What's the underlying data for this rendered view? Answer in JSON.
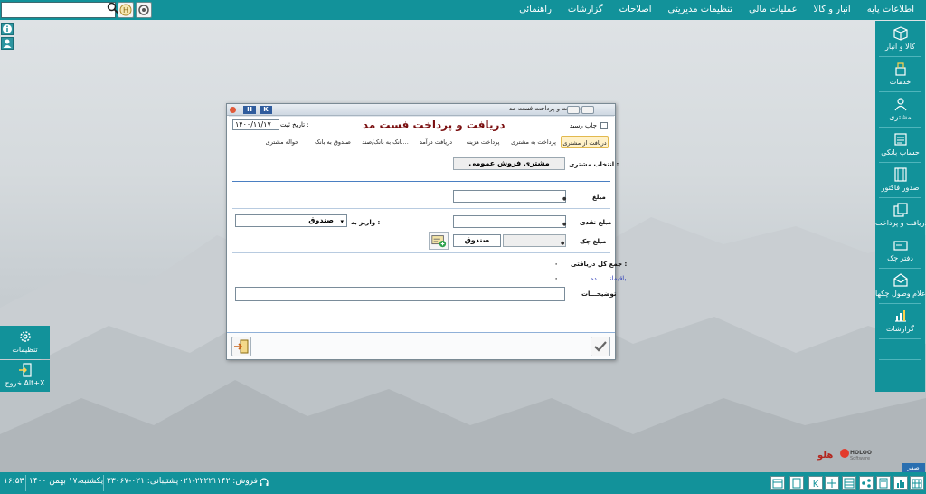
{
  "menu": [
    "اطلاعات پایه",
    "انبار و کالا",
    "عملیات مالی",
    "تنظیمات مدیریتی",
    "اصلاحات",
    "گزارشات",
    "راهنمائی"
  ],
  "search": {
    "placeholder": ""
  },
  "sidebar": [
    {
      "label": "کالا و انبار",
      "icon": "box-icon"
    },
    {
      "label": "خدمات",
      "icon": "services-icon"
    },
    {
      "label": "مشتری",
      "icon": "customer-icon"
    },
    {
      "label": "حساب بانکی",
      "icon": "bank-account-icon"
    },
    {
      "label": "صدور فاکتور",
      "icon": "invoice-icon"
    },
    {
      "label": "دریافت و پرداخت",
      "icon": "payment-icon"
    },
    {
      "label": "دفتر چک",
      "icon": "checkbook-icon"
    },
    {
      "label": "اعلام وصول چکها",
      "icon": "check-clearing-icon"
    },
    {
      "label": "گزارشات",
      "icon": "reports-icon"
    },
    {
      "label": "تنظیمات",
      "icon": "settings-icon"
    },
    {
      "label": "خروج Alt+X",
      "icon": "exit-icon"
    }
  ],
  "dialog": {
    "window_title": "دریافت و پرداخت  فست مد",
    "hk_h": "H",
    "hk_k": "K",
    "heading": "دریافت و پرداخت  فست مد",
    "print_receipt": "چاپ رسید",
    "date_label": "تاریخ ثبت :",
    "date_value": "۱۴۰۰/۱۱/۱۷",
    "tabs": [
      "دریافت از مشتری",
      "پرداخت به مشتری",
      "پرداخت هزینه",
      "دریافت درآمد",
      "بانک به بانک/صند...",
      "صندوق به بانک",
      "حواله مشتری"
    ],
    "customer_label": "انتخاب مشتری :",
    "customer_value": "مشتری فروش عمومی",
    "amount_label": "مبلغ",
    "cash_label": "مبلغ نقدی",
    "deposit_label": "واریز به :",
    "deposit_value": "صندوق",
    "check_label": "مبلغ چک",
    "check_dest": "صندوق",
    "total_label": "جمع کل دریافتی :",
    "total_value": "۰",
    "remaining_label": "باقیمانـــــــده",
    "remaining_value": "۰",
    "desc_label": "توضیحـــات"
  },
  "status": {
    "datetime": "یکشنبه،۱۷ بهمن ۱۴۰۰",
    "time": "۱۶:۵۳",
    "support": "پشتیبانی: ۰۲۱-۲۳۰۶۷",
    "sales": "۰۲۱-۲۲۲۲۱۱۴۲  :فروش"
  },
  "logo": {
    "brand": "هلو",
    "latin": "HOLOO",
    "sub": "Software"
  },
  "currency": "صفر ریال"
}
